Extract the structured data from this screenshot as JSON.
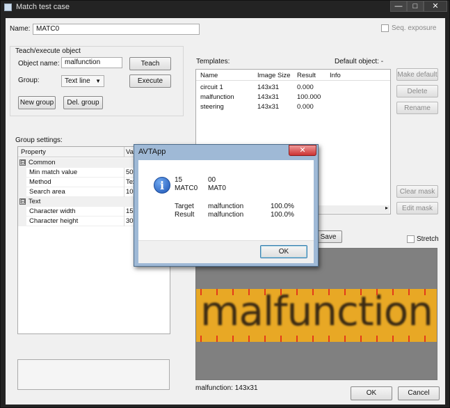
{
  "window": {
    "title": "Match test case",
    "min_label": "—",
    "max_label": "□",
    "close_label": "✕"
  },
  "name": {
    "label": "Name:",
    "value": "MATC0"
  },
  "seq_exposure": {
    "label": "Seq. exposure",
    "checked": false
  },
  "teach": {
    "group_title": "Teach/execute object",
    "object_name_label": "Object name:",
    "object_name_value": "malfunction",
    "teach_button": "Teach",
    "group_label": "Group:",
    "group_value": "Text line",
    "execute_button": "Execute",
    "new_group_button": "New group",
    "del_group_button": "Del. group"
  },
  "group_settings": {
    "title": "Group settings:",
    "columns": [
      "Property",
      "Valu"
    ],
    "rows": [
      {
        "type": "category",
        "label": "Common",
        "expander": "⊟"
      },
      {
        "type": "prop",
        "name": "Min match value",
        "value": "50"
      },
      {
        "type": "prop",
        "name": "Method",
        "value": "Tex"
      },
      {
        "type": "prop",
        "name": "Search area",
        "value": "10"
      },
      {
        "type": "category",
        "label": "Text",
        "expander": "⊟"
      },
      {
        "type": "prop",
        "name": "Character width",
        "value": "15"
      },
      {
        "type": "prop",
        "name": "Character height",
        "value": "30"
      }
    ]
  },
  "templates": {
    "title": "Templates:",
    "default_object": "Default object: -",
    "columns": [
      "Name",
      "Image Size",
      "Result",
      "Info"
    ],
    "rows": [
      {
        "name": "circuit 1",
        "size": "143x31",
        "result": "0.000"
      },
      {
        "name": "malfunction",
        "size": "143x31",
        "result": "100.000"
      },
      {
        "name": "steering",
        "size": "143x31",
        "result": "0.000"
      }
    ]
  },
  "side_buttons": {
    "make_default": "Make default",
    "delete": "Delete",
    "rename": "Rename",
    "clear_mask": "Clear mask",
    "edit_mask": "Edit mask"
  },
  "save_button": "Save",
  "stretch": {
    "label": "Stretch",
    "checked": false
  },
  "preview": {
    "text": "malfunction",
    "caption": "malfunction: 143x31"
  },
  "ok_button": "OK",
  "cancel_button": "Cancel",
  "dialog": {
    "title": "AVTApp",
    "close_label": "✕",
    "icon_glyph": "i",
    "line1_a": "15",
    "line1_b": "00",
    "line2_a": "MATC0",
    "line2_b": "MAT0",
    "target_label": "Target",
    "target_value": "malfunction",
    "target_pct": "100.0%",
    "result_label": "Result",
    "result_value": "malfunction",
    "result_pct": "100.0%",
    "ok_button": "OK"
  },
  "colors": {
    "preview_strip": "#e8a825",
    "tick": "#e23a1a",
    "dialog_frame": "#9fb9d6"
  }
}
